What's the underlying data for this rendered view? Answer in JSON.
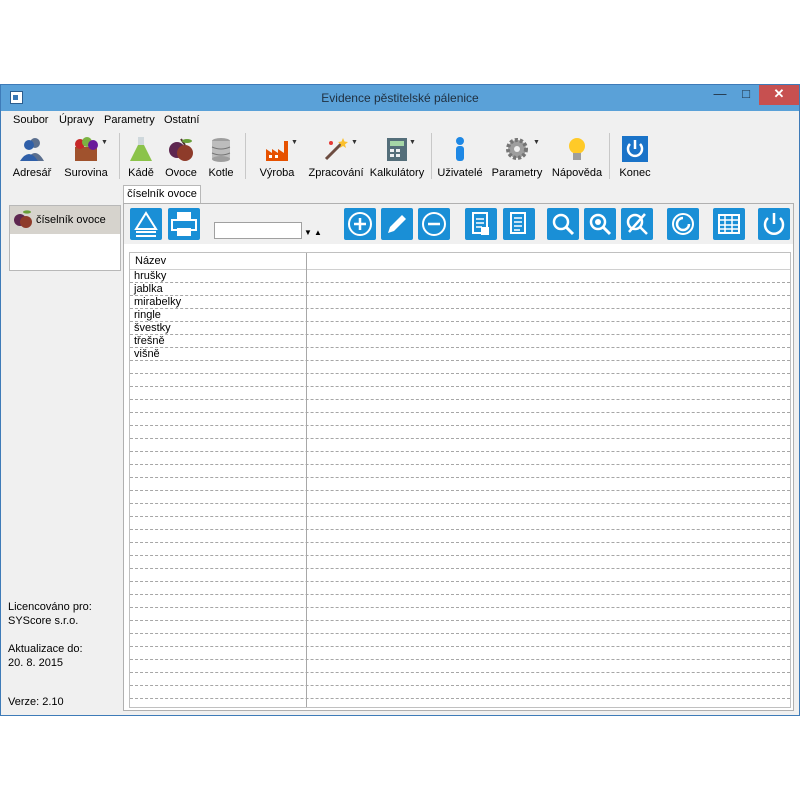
{
  "window": {
    "title": "Evidence pěstitelské pálenice"
  },
  "menu": [
    "Soubor",
    "Úpravy",
    "Parametry",
    "Ostatní"
  ],
  "toolbar": {
    "adresar": "Adresář",
    "surovina": "Surovina",
    "kade": "Kádě",
    "ovoce": "Ovoce",
    "kotle": "Kotle",
    "vyroba": "Výroba",
    "zpracovani": "Zpracování",
    "kalkulatory": "Kalkulátory",
    "uzivatele": "Uživatelé",
    "parametry": "Parametry",
    "napoveda": "Nápověda",
    "konec": "Konec"
  },
  "tab": {
    "label": "číselník ovoce"
  },
  "left_pane": {
    "item": "číselník ovoce"
  },
  "info": {
    "license_label": "Licencováno pro:",
    "license_value": "SYScore s.r.o.",
    "update_label": "Aktualizace do:",
    "update_value": "20. 8. 2015",
    "version": "Verze: 2.10"
  },
  "filter": {
    "value": ""
  },
  "grid": {
    "column": "Název",
    "rows": [
      "hrušky",
      "jablka",
      "mirabelky",
      "ringle",
      "švestky",
      "třešně",
      "višně"
    ]
  },
  "colors": {
    "accent": "#1a8fd6",
    "titlebar": "#5aa1d8",
    "close": "#c75050"
  }
}
